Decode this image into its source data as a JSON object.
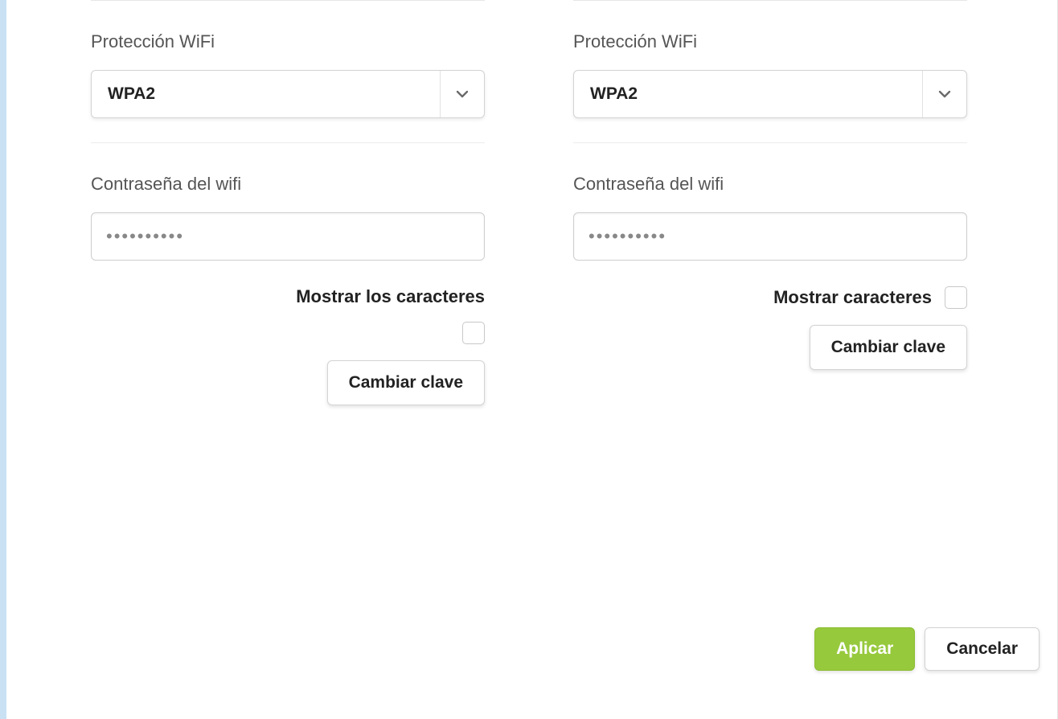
{
  "left": {
    "protection_label": "Protección WiFi",
    "protection_value": "WPA2",
    "password_label": "Contraseña del wifi",
    "password_value": "••••••••••",
    "show_chars_label": "Mostrar los caracteres",
    "change_key_label": "Cambiar clave"
  },
  "right": {
    "protection_label": "Protección WiFi",
    "protection_value": "WPA2",
    "password_label": "Contraseña del wifi",
    "password_value": "••••••••••",
    "show_chars_label": "Mostrar caracteres",
    "change_key_label": "Cambiar clave"
  },
  "footer": {
    "apply_label": "Aplicar",
    "cancel_label": "Cancelar"
  }
}
